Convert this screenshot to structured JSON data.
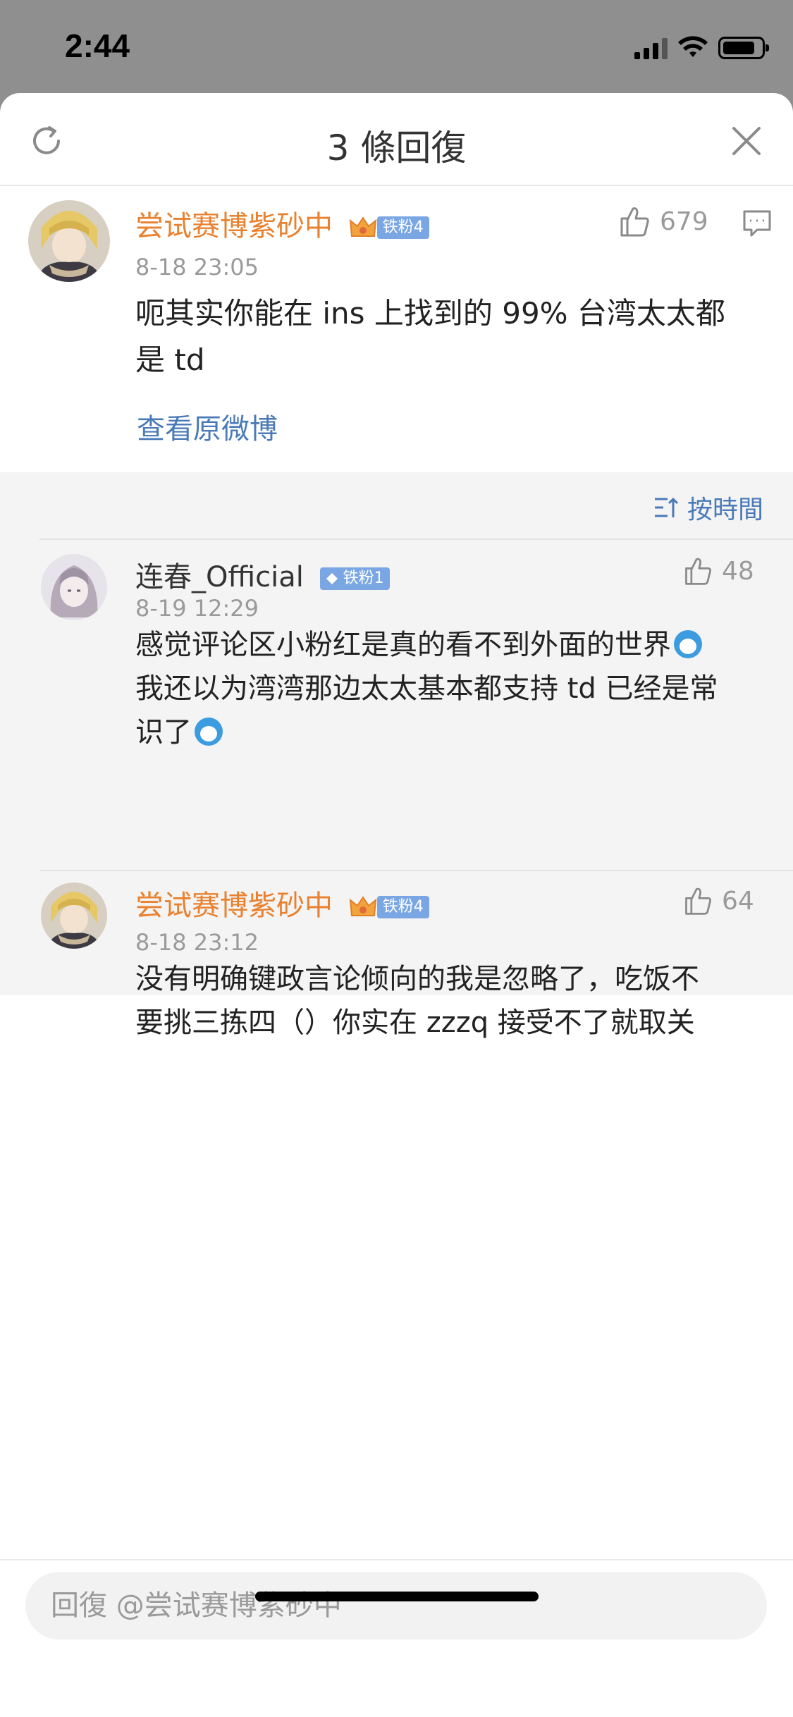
{
  "status_bar": {
    "time": "2:44"
  },
  "header": {
    "title": "3 條回復"
  },
  "main_comment": {
    "author": "尝试赛博紫砂中",
    "fan_badge": "铁粉4",
    "time": "8-18 23:05",
    "likes": "679",
    "text_line1": "呃其实你能在 ins 上找到的 99% 台湾太太都",
    "text_line2": "是 td",
    "view_original": "查看原微博"
  },
  "sort_label": "按時間",
  "replies": [
    {
      "author": "连春_Official",
      "fan_badge": "铁粉1",
      "time": "8-19 12:29",
      "likes": "48",
      "line1": "感觉评论区小粉红是真的看不到外面的世界",
      "line2": "我还以为湾湾那边太太基本都支持 td 已经是常",
      "line3": "识了"
    },
    {
      "author": "尝试赛博紫砂中",
      "fan_badge": "铁粉4",
      "time": "8-18 23:12",
      "likes": "64",
      "line1": "没有明确键政言论倾向的我是忽略了，吃饭不",
      "line2": "要挑三拣四（）你实在 zzzq 接受不了就取关"
    }
  ],
  "reply_input": {
    "placeholder": "回復 @尝试赛博紫砂中"
  },
  "colors": {
    "accent_orange": "#e9812e",
    "link_blue": "#4a7ab8",
    "badge_blue": "#7aa7e4"
  }
}
